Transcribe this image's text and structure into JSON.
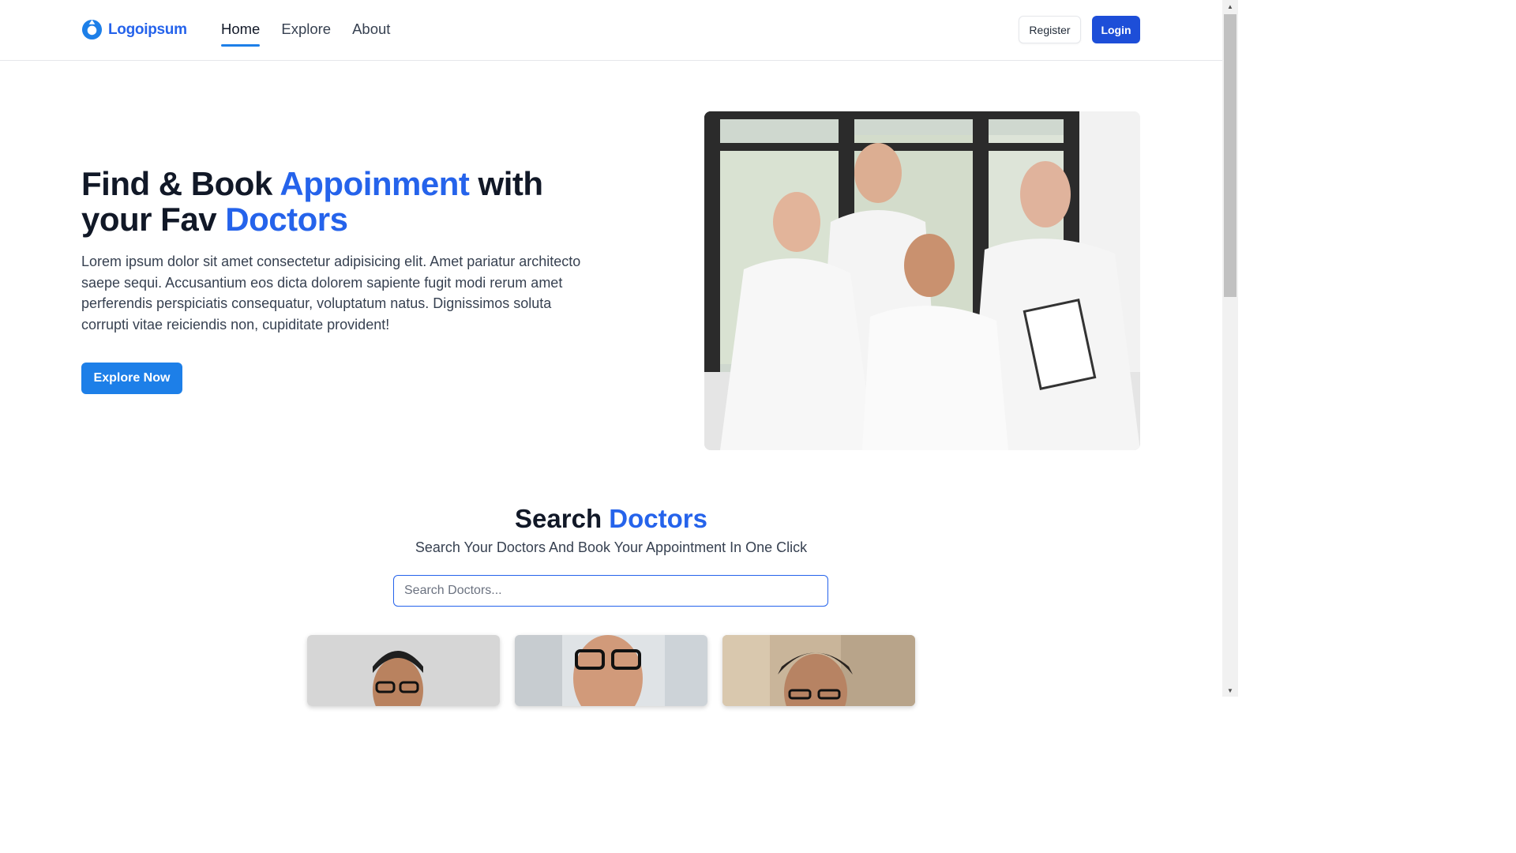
{
  "nav": {
    "brand": "Logoipsum",
    "links": [
      {
        "label": "Home",
        "active": true
      },
      {
        "label": "Explore",
        "active": false
      },
      {
        "label": "About",
        "active": false
      }
    ],
    "register_label": "Register",
    "login_label": "Login"
  },
  "hero": {
    "title_part1": "Find & Book ",
    "title_accent1": "Appoinment",
    "title_part2": " with your Fav ",
    "title_accent2": "Doctors",
    "description": "Lorem ipsum dolor sit amet consectetur adipisicing elit. Amet pariatur architecto saepe sequi. Accusantium eos dicta dolorem sapiente fugit modi rerum amet perferendis perspiciatis consequatur, voluptatum natus. Dignissimos soluta corrupti vitae reiciendis non, cupiditate provident!",
    "cta_label": "Explore Now"
  },
  "search": {
    "title_part1": "Search ",
    "title_accent": "Doctors",
    "subtitle": "Search Your Doctors And Book Your Appointment In One Click",
    "placeholder": "Search Doctors..."
  },
  "colors": {
    "accent": "#2563eb",
    "primary_button": "#1d4ed8",
    "explore_button": "#1d7fe8"
  }
}
